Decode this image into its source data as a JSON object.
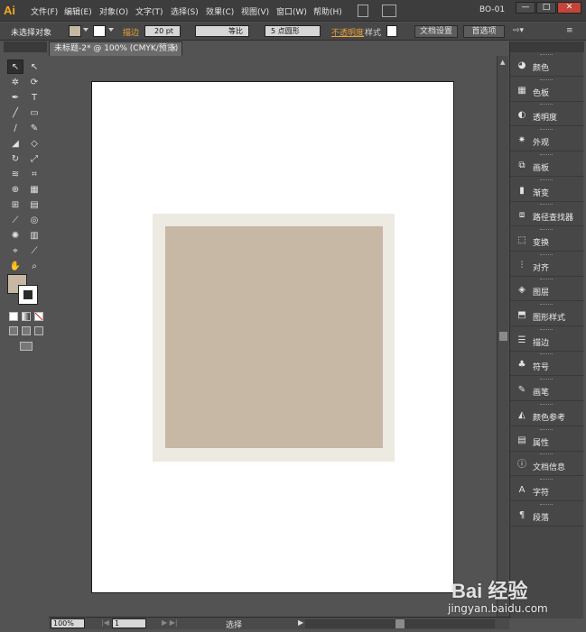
{
  "app": {
    "logo": "Ai",
    "workspace": "BO-01"
  },
  "menu": [
    "文件(F)",
    "编辑(E)",
    "对象(O)",
    "文字(T)",
    "选择(S)",
    "效果(C)",
    "视图(V)",
    "窗口(W)",
    "帮助(H)"
  ],
  "window_controls": {
    "minimize": "—",
    "maximize": "□",
    "close": "✕"
  },
  "control_bar": {
    "selection_status": "未选择对象",
    "stroke_label": "描边",
    "stroke_weight": "20 pt",
    "stroke_profile": "等比",
    "brush": "5 点圆形",
    "opacity_label": "不透明度",
    "style_label": "样式",
    "doc_setup_button": "文档设置",
    "preferences_button": "首选项"
  },
  "document": {
    "tab_title": "未标题-2* @ 100% (CMYK/预览)",
    "close_glyph": "×"
  },
  "artwork": {
    "outer_color": "#eceae1",
    "inner_color": "#c7b7a5"
  },
  "status_bar": {
    "zoom": "100%",
    "artboard_number": "1",
    "tool_status": "选择"
  },
  "panels": [
    {
      "label": "颜色",
      "icon": "color-icon"
    },
    {
      "label": "色板",
      "icon": "swatches-icon"
    },
    {
      "label": "透明度",
      "icon": "transparency-icon"
    },
    {
      "label": "外观",
      "icon": "appearance-icon"
    },
    {
      "label": "画板",
      "icon": "artboards-icon"
    },
    {
      "label": "渐变",
      "icon": "gradient-icon"
    },
    {
      "label": "路径查找器",
      "icon": "pathfinder-icon"
    },
    {
      "label": "变换",
      "icon": "transform-icon"
    },
    {
      "label": "对齐",
      "icon": "align-icon"
    },
    {
      "label": "图层",
      "icon": "layers-icon"
    },
    {
      "label": "图形样式",
      "icon": "graphic-styles-icon"
    },
    {
      "label": "描边",
      "icon": "stroke-icon"
    },
    {
      "label": "符号",
      "icon": "symbols-icon"
    },
    {
      "label": "画笔",
      "icon": "brushes-icon"
    },
    {
      "label": "颜色参考",
      "icon": "color-guide-icon"
    },
    {
      "label": "属性",
      "icon": "attributes-icon"
    },
    {
      "label": "文档信息",
      "icon": "document-info-icon"
    },
    {
      "label": "字符",
      "icon": "character-icon"
    },
    {
      "label": "段落",
      "icon": "paragraph-icon"
    }
  ],
  "watermark": {
    "logo": "Bai 经验",
    "url": "jingyan.baidu.com"
  }
}
